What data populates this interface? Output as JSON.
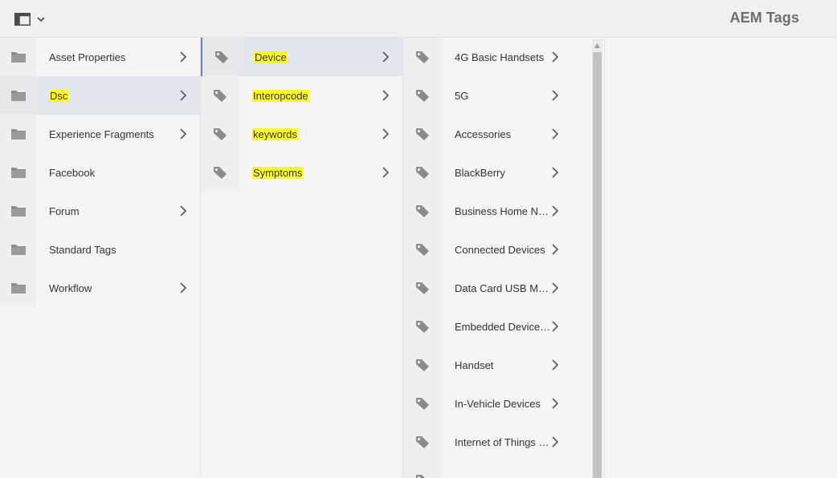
{
  "header": {
    "title": "AEM Tags"
  },
  "columns": {
    "col1": [
      {
        "label": "Asset Properties",
        "has_children": true,
        "selected": false,
        "highlight": false
      },
      {
        "label": "Dsc",
        "has_children": true,
        "selected": true,
        "highlight": true
      },
      {
        "label": "Experience Fragments",
        "has_children": true,
        "selected": false,
        "highlight": false
      },
      {
        "label": "Facebook",
        "has_children": false,
        "selected": false,
        "highlight": false
      },
      {
        "label": "Forum",
        "has_children": true,
        "selected": false,
        "highlight": false
      },
      {
        "label": "Standard Tags",
        "has_children": false,
        "selected": false,
        "highlight": false
      },
      {
        "label": "Workflow",
        "has_children": true,
        "selected": false,
        "highlight": false
      }
    ],
    "col2": [
      {
        "label": "Device",
        "has_children": true,
        "selected": true,
        "highlight": true
      },
      {
        "label": "Interopcode",
        "has_children": true,
        "selected": false,
        "highlight": true
      },
      {
        "label": "keywords",
        "has_children": true,
        "selected": false,
        "highlight": true
      },
      {
        "label": "Symptoms",
        "has_children": true,
        "selected": false,
        "highlight": true
      }
    ],
    "col3": [
      {
        "label": "4G Basic Handsets",
        "has_children": true
      },
      {
        "label": "5G",
        "has_children": true
      },
      {
        "label": "Accessories",
        "has_children": true
      },
      {
        "label": "BlackBerry",
        "has_children": true
      },
      {
        "label": "Business Home Net...",
        "has_children": true
      },
      {
        "label": "Connected Devices",
        "has_children": true
      },
      {
        "label": "Data Card USB Mod...",
        "has_children": true
      },
      {
        "label": "Embedded Devices ...",
        "has_children": true
      },
      {
        "label": "Handset",
        "has_children": true
      },
      {
        "label": "In-Vehicle Devices",
        "has_children": true
      },
      {
        "label": "Internet of Things (I...",
        "has_children": true
      },
      {
        "label": "",
        "has_children": false
      }
    ]
  },
  "icons": {
    "rail": "rail-toggle-icon",
    "dropdown": "chevron-down-icon",
    "folder": "folder-icon",
    "tag": "tag-icon",
    "chevron": "chevron-right-icon"
  },
  "colors": {
    "highlight": "#ffff2a",
    "selected_row": "#e3e6ec",
    "selected_border": "#5b84c4",
    "icon_gray": "#8a8a8a"
  }
}
